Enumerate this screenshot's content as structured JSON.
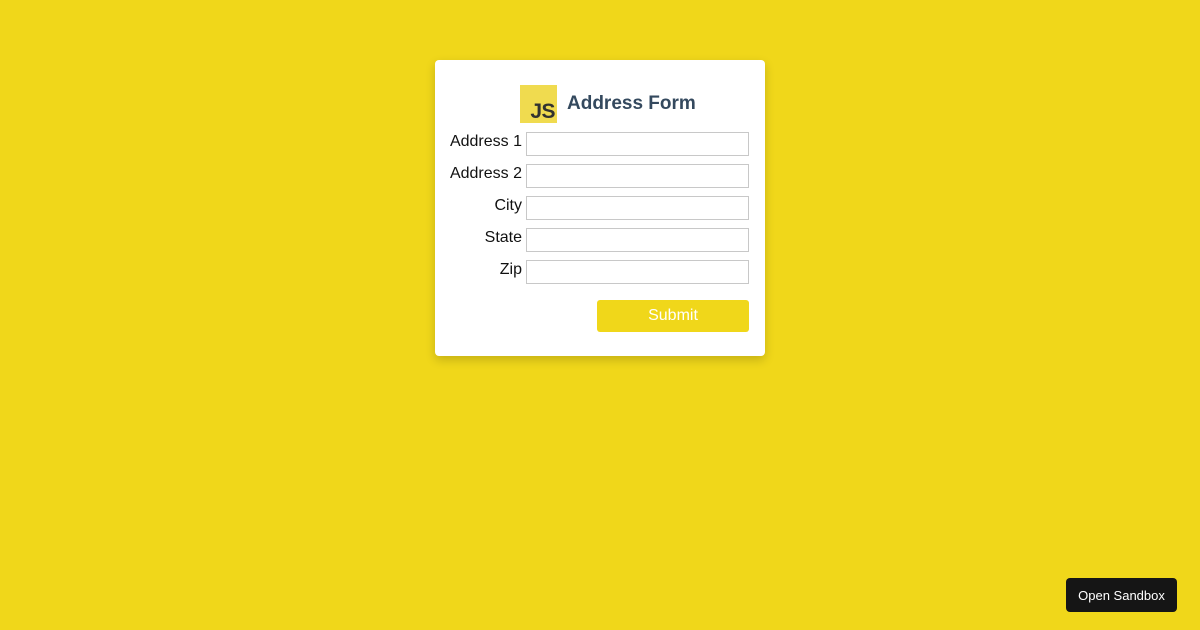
{
  "form": {
    "logo_text": "JS",
    "title": "Address Form",
    "fields": [
      {
        "label": "Address 1",
        "value": "",
        "placeholder": ""
      },
      {
        "label": "Address 2",
        "value": "",
        "placeholder": ""
      },
      {
        "label": "City",
        "value": "",
        "placeholder": ""
      },
      {
        "label": "State",
        "value": "",
        "placeholder": ""
      },
      {
        "label": "Zip",
        "value": "",
        "placeholder": ""
      }
    ],
    "submit_label": "Submit"
  },
  "sandbox": {
    "label": "Open Sandbox"
  },
  "colors": {
    "background": "#f0d71a",
    "card": "#ffffff",
    "title": "#34495e",
    "logo_bg": "#f0db4f",
    "logo_text": "#323330",
    "sandbox_bg": "#151515"
  },
  "icons": {
    "logo": "javascript-logo-icon"
  }
}
